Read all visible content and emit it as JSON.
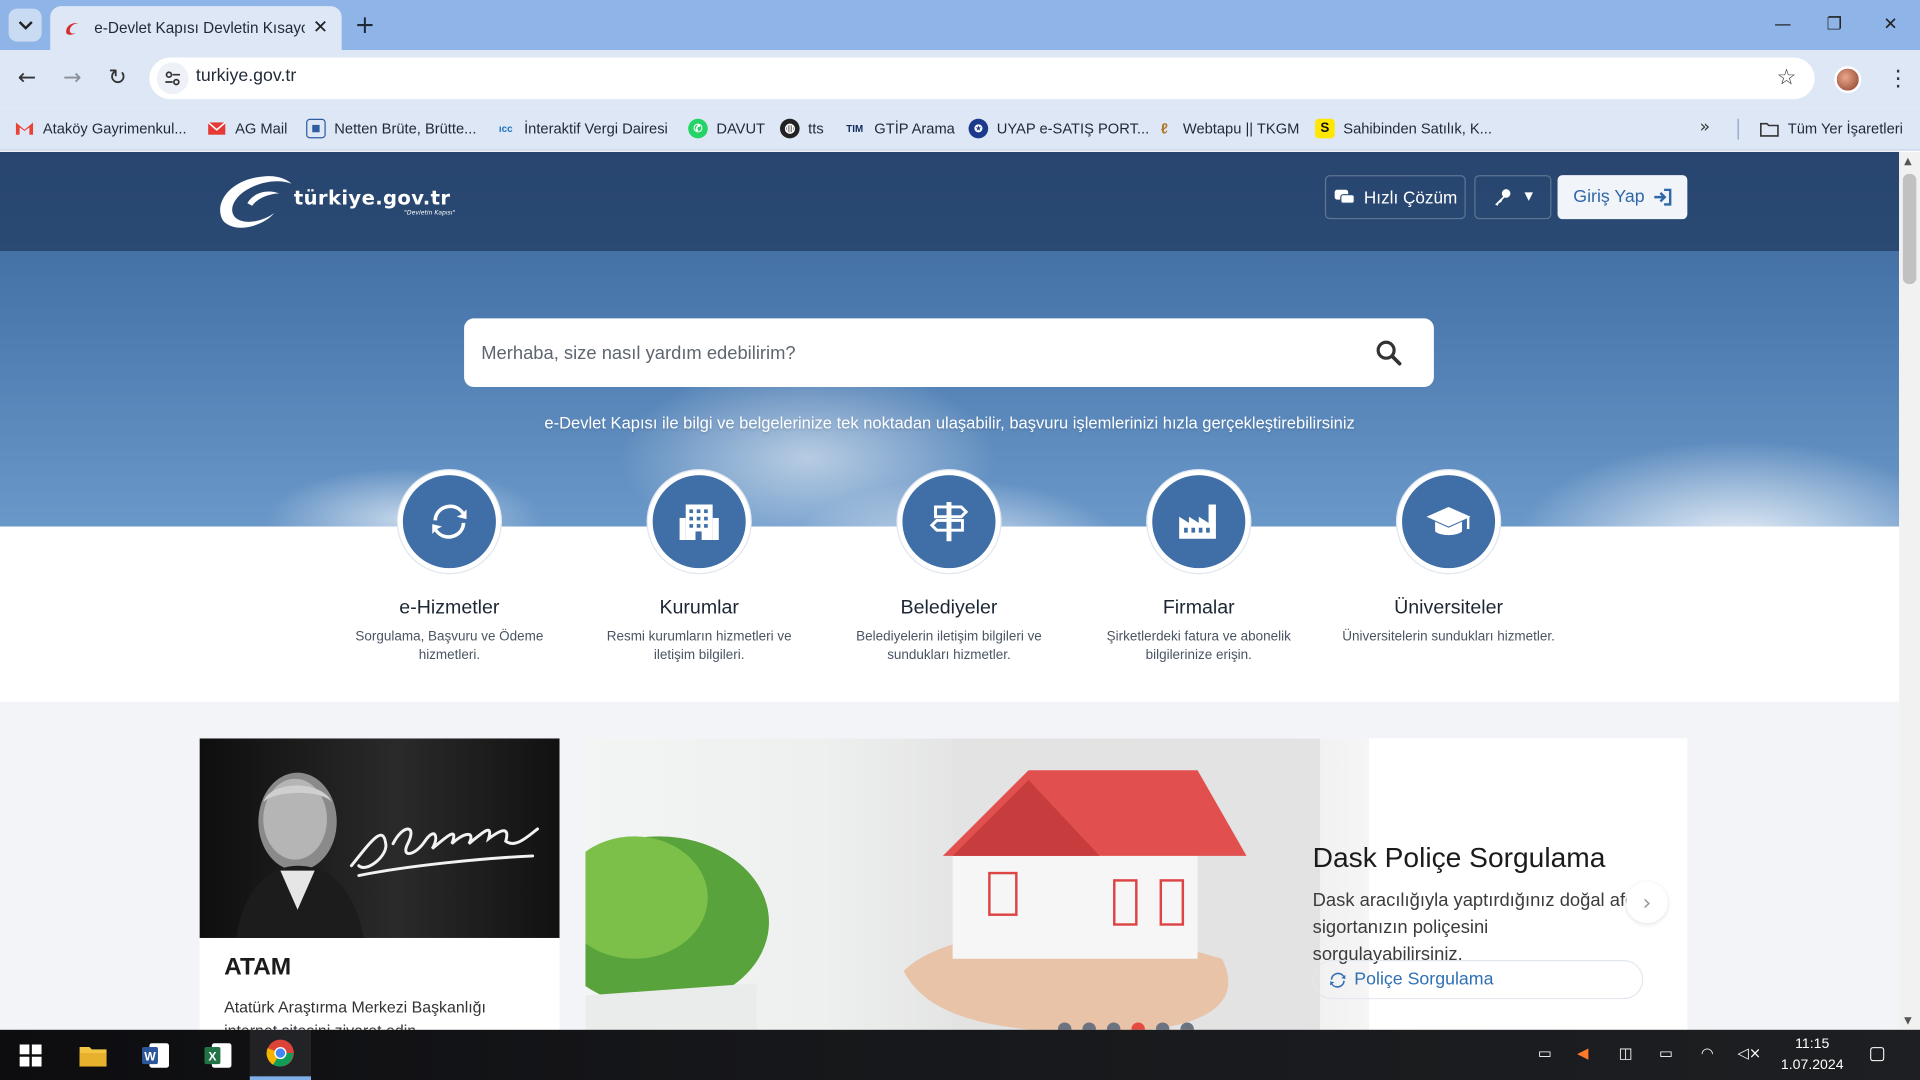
{
  "browser": {
    "tab_title": "e-Devlet Kapısı Devletin Kısayolu",
    "url": "turkiye.gov.tr",
    "bookmarks": [
      {
        "label": "Ataköy Gayrimenkul...",
        "icon": "gmail-icon"
      },
      {
        "label": "AG Mail",
        "icon": "mail-icon"
      },
      {
        "label": "Netten Brüte, Brütte...",
        "icon": "page-icon"
      },
      {
        "label": "İnteraktif Vergi Dairesi",
        "icon": "ivd-icon"
      },
      {
        "label": "DAVUT",
        "icon": "whatsapp-icon"
      },
      {
        "label": "tts",
        "icon": "globe-icon"
      },
      {
        "label": "GTİP Arama",
        "icon": "tim-icon"
      },
      {
        "label": "UYAP e-SATIŞ PORT...",
        "icon": "uyap-icon"
      },
      {
        "label": "Webtapu || TKGM",
        "icon": "tkgm-icon"
      },
      {
        "label": "Sahibinden Satılık, K...",
        "icon": "sahibinden-icon"
      }
    ],
    "all_bookmarks_label": "Tüm Yer İşaretleri"
  },
  "header": {
    "logo_text": "türkiye.gov.tr",
    "logo_slogan": "\"Devletin Kapısı\"",
    "quick_solution_label": "Hızlı Çözüm",
    "login_label": "Giriş Yap"
  },
  "search": {
    "placeholder": "Merhaba, size nasıl yardım edebilirim?",
    "subtitle": "e-Devlet Kapısı ile bilgi ve belgelerinize tek noktadan ulaşabilir, başvuru işlemlerinizi hızla gerçekleştirebilirsiniz"
  },
  "categories": [
    {
      "title": "e-Hizmetler",
      "desc": "Sorgulama, Başvuru ve Ödeme hizmetleri.",
      "icon": "refresh-icon"
    },
    {
      "title": "Kurumlar",
      "desc": "Resmi kurumların hizmetleri ve iletişim bilgileri.",
      "icon": "building-icon"
    },
    {
      "title": "Belediyeler",
      "desc": "Belediyelerin iletişim bilgileri ve sundukları hizmetler.",
      "icon": "signpost-icon"
    },
    {
      "title": "Firmalar",
      "desc": "Şirketlerdeki fatura ve abonelik bilgilerinize erişin.",
      "icon": "factory-icon"
    },
    {
      "title": "Üniversiteler",
      "desc": "Üniversitelerin sundukları hizmetler.",
      "icon": "graduation-cap-icon"
    }
  ],
  "atam": {
    "title": "ATAM",
    "desc": "Atatürk Araştırma Merkezi Başkanlığı internet sitesini ziyaret edin."
  },
  "slide": {
    "title": "Dask Poliçe Sorgulama",
    "desc": "Dask aracılığıyla yaptırdığınız doğal afet sigortanızın poliçesini sorgulayabilirsiniz.",
    "button_label": "Poliçe Sorgulama",
    "dot_count": 6,
    "active_dot": 3
  },
  "taskbar": {
    "time": "11:15",
    "date": "1.07.2024"
  }
}
